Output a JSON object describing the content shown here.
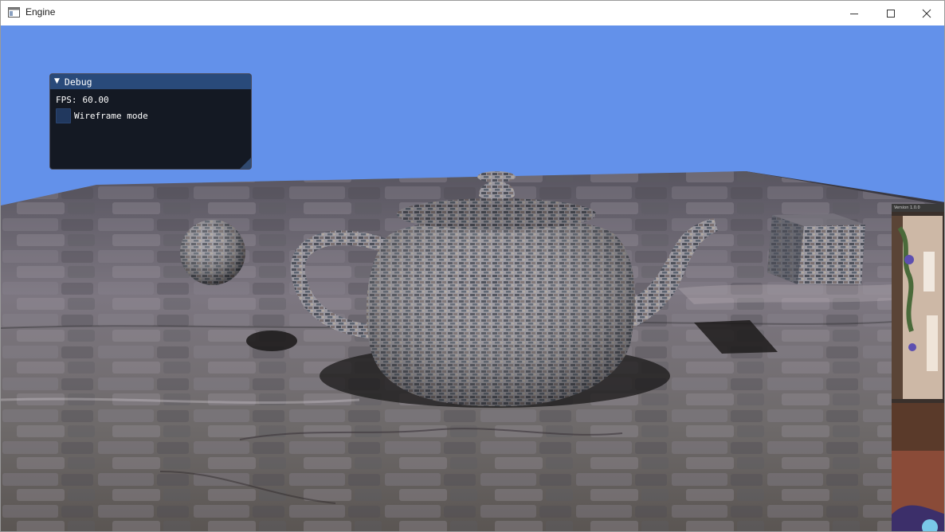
{
  "window": {
    "title": "Engine",
    "app_icon": "window-app-icon",
    "controls": {
      "minimize_icon": "minimize-icon",
      "maximize_icon": "maximize-icon",
      "close_icon": "close-icon"
    }
  },
  "scene": {
    "sky_color": "#6495ed",
    "floor_color": "#6e6a70",
    "objects": [
      "sphere",
      "teapot",
      "cube"
    ]
  },
  "debug": {
    "title": "Debug",
    "collapse_icon": "▼",
    "fps_label": "FPS:",
    "fps_value": "60.00",
    "wireframe_label": "Wireframe mode",
    "wireframe_checked": false,
    "header_color": "#294a7a"
  },
  "side_panel": {
    "header_text": "Version 1.0.0"
  }
}
